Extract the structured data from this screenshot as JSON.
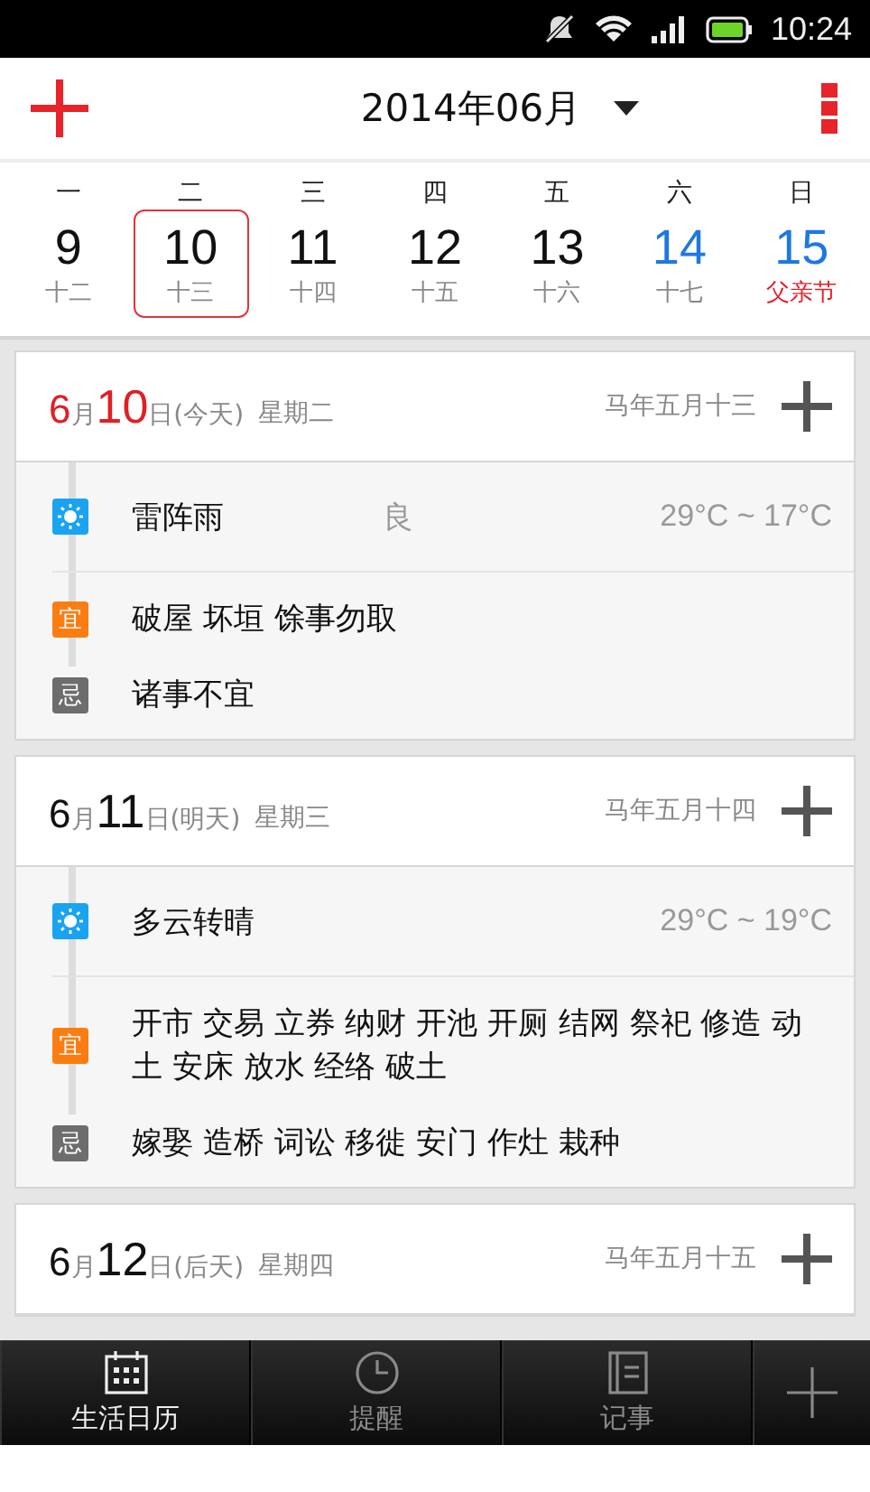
{
  "status_bar": {
    "time": "10:24"
  },
  "header": {
    "title": "2014年06月"
  },
  "week": [
    {
      "weekday": "一",
      "day": "9",
      "lunar": "十二",
      "selected": false,
      "kind": "weekday",
      "festival": false
    },
    {
      "weekday": "二",
      "day": "10",
      "lunar": "十三",
      "selected": true,
      "kind": "weekday",
      "festival": false
    },
    {
      "weekday": "三",
      "day": "11",
      "lunar": "十四",
      "selected": false,
      "kind": "weekday",
      "festival": false
    },
    {
      "weekday": "四",
      "day": "12",
      "lunar": "十五",
      "selected": false,
      "kind": "weekday",
      "festival": false
    },
    {
      "weekday": "五",
      "day": "13",
      "lunar": "十六",
      "selected": false,
      "kind": "weekday",
      "festival": false
    },
    {
      "weekday": "六",
      "day": "14",
      "lunar": "十七",
      "selected": false,
      "kind": "weekend",
      "festival": false
    },
    {
      "weekday": "日",
      "day": "15",
      "lunar": "父亲节",
      "selected": false,
      "kind": "weekend",
      "festival": true
    }
  ],
  "days": [
    {
      "month": "6",
      "month_unit": "月",
      "day": "10",
      "day_suffix": "日(今天)",
      "weekday": "星期二",
      "lunar": "马年五月十三",
      "today": true,
      "weather": {
        "kind": "sun",
        "text": "雷阵雨",
        "air": "良",
        "temperature": "29°C ~ 17°C"
      },
      "almanac": [
        {
          "kind": "yi",
          "badge": "宜",
          "text": "破屋 坏垣 馀事勿取"
        },
        {
          "kind": "ji",
          "badge": "忌",
          "text": "诸事不宜"
        }
      ]
    },
    {
      "month": "6",
      "month_unit": "月",
      "day": "11",
      "day_suffix": "日(明天)",
      "weekday": "星期三",
      "lunar": "马年五月十四",
      "today": false,
      "weather": {
        "kind": "sun",
        "text": "多云转晴",
        "temperature": "29°C ~ 19°C"
      },
      "almanac": [
        {
          "kind": "yi",
          "badge": "宜",
          "text": "开市 交易 立券 纳财 开池 开厕 结网 祭祀 修造 动土 安床 放水 经络 破土"
        },
        {
          "kind": "ji",
          "badge": "忌",
          "text": "嫁娶 造桥 词讼 移徙 安门 作灶 栽种"
        }
      ]
    },
    {
      "month": "6",
      "month_unit": "月",
      "day": "12",
      "day_suffix": "日(后天)",
      "weekday": "星期四",
      "lunar": "马年五月十五",
      "today": false
    }
  ],
  "tabs": [
    {
      "kind": "calendar",
      "label": "生活日历",
      "selected": true
    },
    {
      "kind": "clock",
      "label": "提醒",
      "selected": false
    },
    {
      "kind": "notebook",
      "label": "记事",
      "selected": false
    }
  ]
}
